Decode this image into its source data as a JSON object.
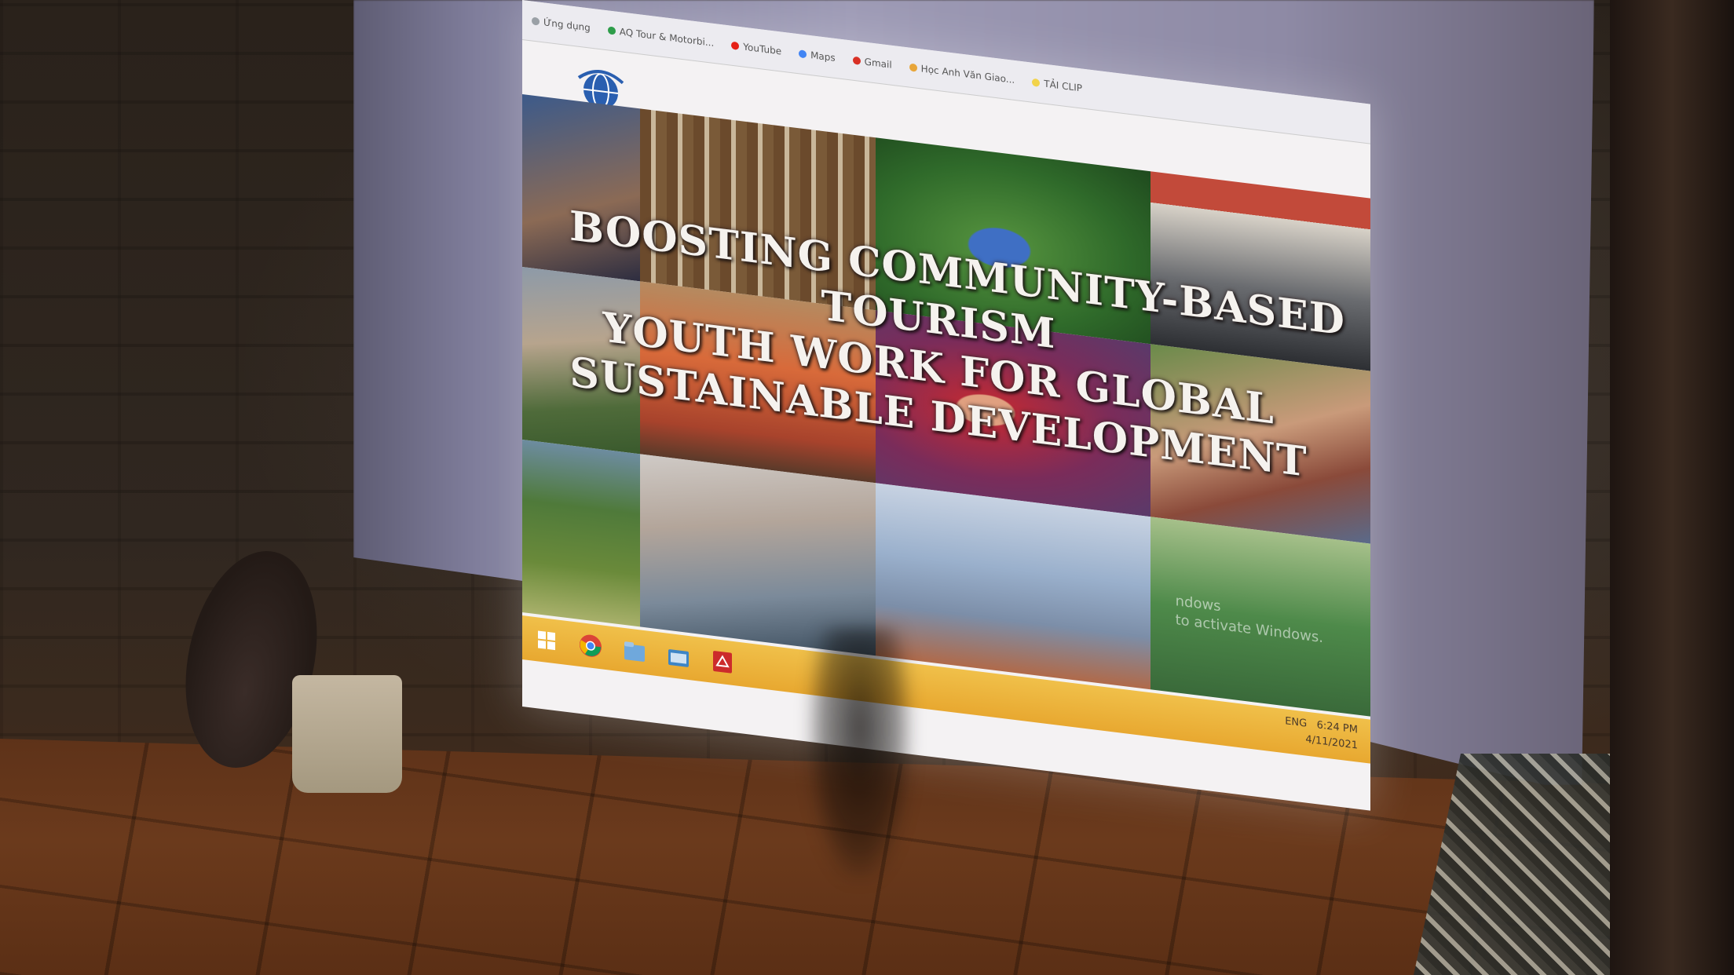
{
  "browser": {
    "bookmarks": [
      "Ứng dụng",
      "AQ Tour & Motorbi...",
      "YouTube",
      "Maps",
      "Gmail",
      "Học Anh Văn Giao...",
      "TẢI CLIP"
    ],
    "bookmark_colors": [
      "#9aa0a6",
      "#2e9d4a",
      "#e62117",
      "#4285f4",
      "#d93025",
      "#e8a63a",
      "#f2d34a"
    ]
  },
  "slide": {
    "title_lines": [
      "Boosting Community-Based",
      "Tourism",
      "Youth Work for Global",
      "Sustainable Development"
    ]
  },
  "watermark": {
    "line1": "ndows",
    "line2": "to activate Windows."
  },
  "taskbar": {
    "icons": [
      "windows-start-icon",
      "chrome-icon",
      "file-explorer-icon",
      "folder-icon",
      "pdf-reader-icon"
    ],
    "icon_colors": [
      "#ffffff",
      "#db4437",
      "#6fa8dc",
      "#3d85c6",
      "#cc2b2b"
    ],
    "time": "6:24 PM",
    "date": "4/11/2021",
    "language": "ENG"
  }
}
